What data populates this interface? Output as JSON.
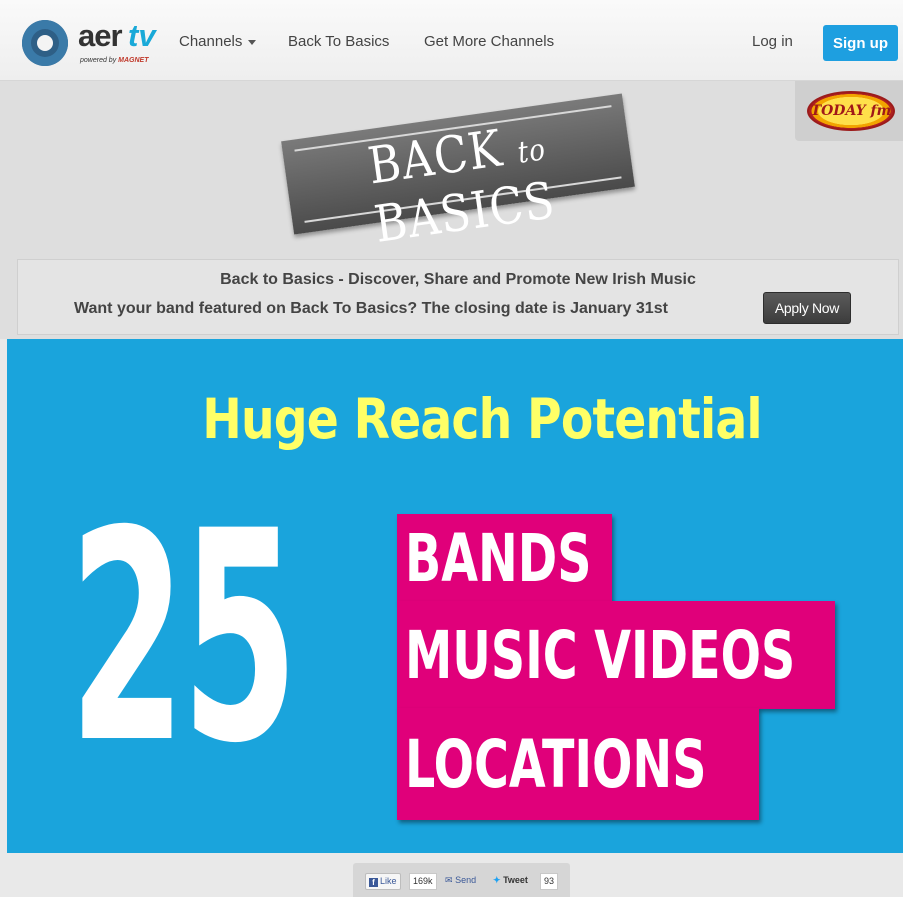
{
  "navbar": {
    "logo": {
      "brand_main": "aer",
      "brand_accent": "tv",
      "powered_by": "powered by",
      "powered_brand": "MAGNET"
    },
    "links": [
      "Channels",
      "Back To Basics",
      "Get More Channels"
    ],
    "login": "Log in",
    "signup": "Sign up"
  },
  "banner": {
    "radio_logo": "TODAY fm",
    "ribbon_back": "BACK",
    "ribbon_to": "to",
    "ribbon_basics": "BASICS",
    "tagline": "Back to Basics - Discover, Share and Promote New Irish Music",
    "cta_text": "Want your band featured on Back To Basics? The closing date is January 31st",
    "apply_button": "Apply Now"
  },
  "hero": {
    "headline": "Huge Reach Potential",
    "number": "25",
    "items": [
      "BANDS",
      "MUSIC VIDEOS",
      "LOCATIONS"
    ]
  },
  "social": {
    "like": "Like",
    "like_count": "169k",
    "send": "Send",
    "tweet": "Tweet",
    "tweet_count": "93"
  },
  "colors": {
    "accent_blue": "#1e9fe0",
    "hero_blue": "#1aa4dc",
    "headline_yellow": "#ffff66",
    "highlight_pink": "#e0007a"
  }
}
